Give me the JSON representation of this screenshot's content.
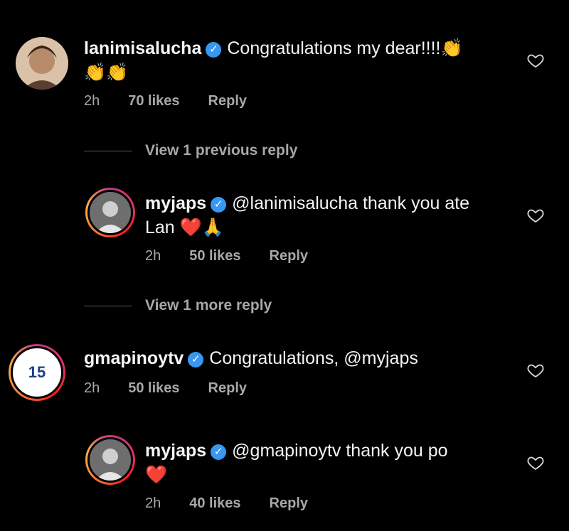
{
  "comments": [
    {
      "username": "lanimisalucha",
      "text_line1": "Congratulations my dear!!!!👏",
      "text_line2": "👏👏",
      "time": "2h",
      "likes": "70 likes",
      "reply": "Reply"
    },
    {
      "username": "myjaps",
      "text_line1": "@lanimisalucha thank you ate",
      "text_line2": "Lan ❤️🙏",
      "time": "2h",
      "likes": "50 likes",
      "reply": "Reply"
    },
    {
      "username": "gmapinoytv",
      "text_line1": "Congratulations, @myjaps",
      "time": "2h",
      "likes": "50 likes",
      "reply": "Reply",
      "avatar_text": "15"
    },
    {
      "username": "myjaps",
      "text_line1": "@gmapinoytv thank you po",
      "text_line2": "❤️",
      "time": "2h",
      "likes": "40 likes",
      "reply": "Reply"
    }
  ],
  "view_previous": "View 1 previous reply",
  "view_more": "View 1 more reply",
  "verified_glyph": "✓",
  "colors": {
    "background": "#000000",
    "text": "#f5f5f5",
    "muted": "#a8a8a8",
    "verified": "#3897f0"
  }
}
